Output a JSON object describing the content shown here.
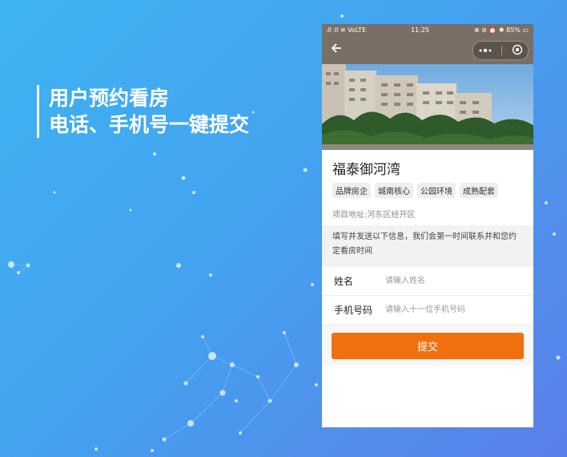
{
  "headline": {
    "line1": "用户预约看房",
    "line2": "电话、手机号一键提交"
  },
  "statusbar": {
    "left": "ᵢll ᵢll ≋ VoLTE",
    "time": "11:25",
    "right": "⊕ ⊘ ⏰ ✱ 85% ▭"
  },
  "navbar": {
    "back_icon": "arrow-left-icon",
    "more_icon": "more-dots-icon",
    "close_icon": "target-icon"
  },
  "property": {
    "name": "福泰御河湾",
    "tags": [
      "品牌房企",
      "城南核心",
      "公园环境",
      "成熟配套"
    ],
    "address": "项目地址:河东区经开区"
  },
  "notice": "填写并发送以下信息，我们会第一时间联系并和您约定看房时间",
  "form": {
    "name_label": "姓名",
    "name_placeholder": "请输入姓名",
    "phone_label": "手机号码",
    "phone_placeholder": "请输入十一位手机号码",
    "submit_label": "提交"
  },
  "colors": {
    "accent": "#f0700f",
    "header": "#7a6f66"
  }
}
